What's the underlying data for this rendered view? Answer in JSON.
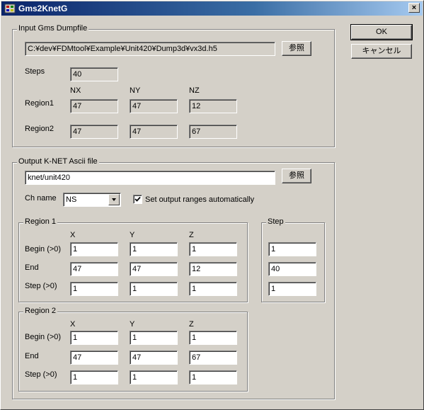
{
  "window": {
    "title": "Gms2KnetG",
    "close_glyph": "×",
    "icon": "app-icon"
  },
  "buttons": {
    "ok": "OK",
    "cancel": "キャンセル",
    "browse": "参照"
  },
  "input_group": {
    "legend": "Input Gms Dumpfile",
    "path": "C:¥dev¥FDMtool¥Example¥Unit420¥Dump3d¥vx3d.h5",
    "steps_label": "Steps",
    "steps_value": "40",
    "col_nx": "NX",
    "col_ny": "NY",
    "col_nz": "NZ",
    "region1_label": "Region1",
    "region1": [
      "47",
      "47",
      "12"
    ],
    "region2_label": "Region2",
    "region2": [
      "47",
      "47",
      "67"
    ]
  },
  "output_group": {
    "legend": "Output K-NET Ascii file",
    "path": "knet/unit420",
    "ch_name_label": "Ch name",
    "ch_name_value": "NS",
    "auto_range_label": "Set output ranges automatically",
    "auto_range_checked": true,
    "region1": {
      "legend": "Region 1",
      "col_x": "X",
      "col_y": "Y",
      "col_z": "Z",
      "begin_label": "Begin (>0)",
      "end_label": "End",
      "step_label": "Step (>0)",
      "begin": [
        "1",
        "1",
        "1"
      ],
      "end": [
        "47",
        "47",
        "12"
      ],
      "step": [
        "1",
        "1",
        "1"
      ]
    },
    "step_box": {
      "legend": "Step",
      "begin": "1",
      "end": "40",
      "step": "1"
    },
    "region2": {
      "legend": "Region 2",
      "col_x": "X",
      "col_y": "Y",
      "col_z": "Z",
      "begin_label": "Begin (>0)",
      "end_label": "End",
      "step_label": "Step (>0)",
      "begin": [
        "1",
        "1",
        "1"
      ],
      "end": [
        "47",
        "47",
        "67"
      ],
      "step": [
        "1",
        "1",
        "1"
      ]
    }
  },
  "colors": {
    "titlebar_start": "#0a246a",
    "titlebar_end": "#a6caf0",
    "face": "#d4d0c8"
  }
}
